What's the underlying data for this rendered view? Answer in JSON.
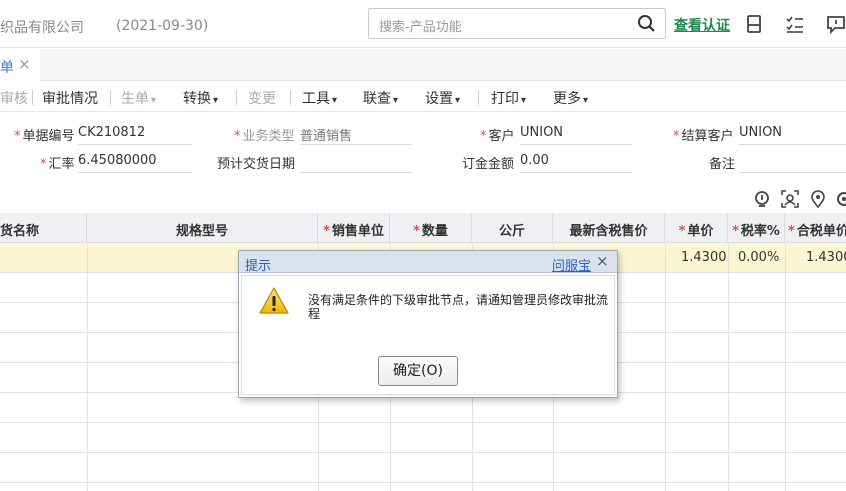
{
  "header": {
    "company": "织品有限公司",
    "date": "(2021-09-30)",
    "search_placeholder": "搜索-产品功能",
    "verify_label": "查看认证"
  },
  "tab": {
    "label": "单",
    "close": "×"
  },
  "toolbar": {
    "audit": "审核",
    "approval_status": "审批情况",
    "generate": "生单",
    "convert": "转换",
    "change": "变更",
    "tools": "工具",
    "linked_query": "联查",
    "settings": "设置",
    "print": "打印",
    "more": "更多"
  },
  "form": {
    "doc_no_label": "单据编号",
    "doc_no_value": "CK210812",
    "biz_type_label": "业务类型",
    "biz_type_value": "普通销售",
    "customer_label": "客户",
    "customer_value": "UNION",
    "settle_customer_label": "结算客户",
    "settle_customer_value": "UNION",
    "rate_label": "汇率",
    "rate_value": "6.45080000",
    "delivery_date_label": "预计交货日期",
    "delivery_date_value": "",
    "deposit_label": "订金金额",
    "deposit_value": "0.00",
    "remark_label": "备注",
    "remark_value": ""
  },
  "grid": {
    "columns": [
      {
        "label": "货名称",
        "required": false
      },
      {
        "label": "规格型号",
        "required": false
      },
      {
        "label": "销售单位",
        "required": true
      },
      {
        "label": "数量",
        "required": true
      },
      {
        "label": "公斤",
        "required": false
      },
      {
        "label": "最新含税售价",
        "required": false
      },
      {
        "label": "单价",
        "required": true
      },
      {
        "label": "税率%",
        "required": true
      },
      {
        "label": "合税单价",
        "required": true
      }
    ],
    "row1": {
      "price": "1.4300",
      "tax_rate": "0.00%",
      "tax_price": "1.4300"
    }
  },
  "dialog": {
    "title": "提示",
    "help_link": "问服宝",
    "close": "×",
    "message": "没有满足条件的下级审批节点，请通知管理员修改审批流程",
    "ok_label": "确定(O)"
  }
}
